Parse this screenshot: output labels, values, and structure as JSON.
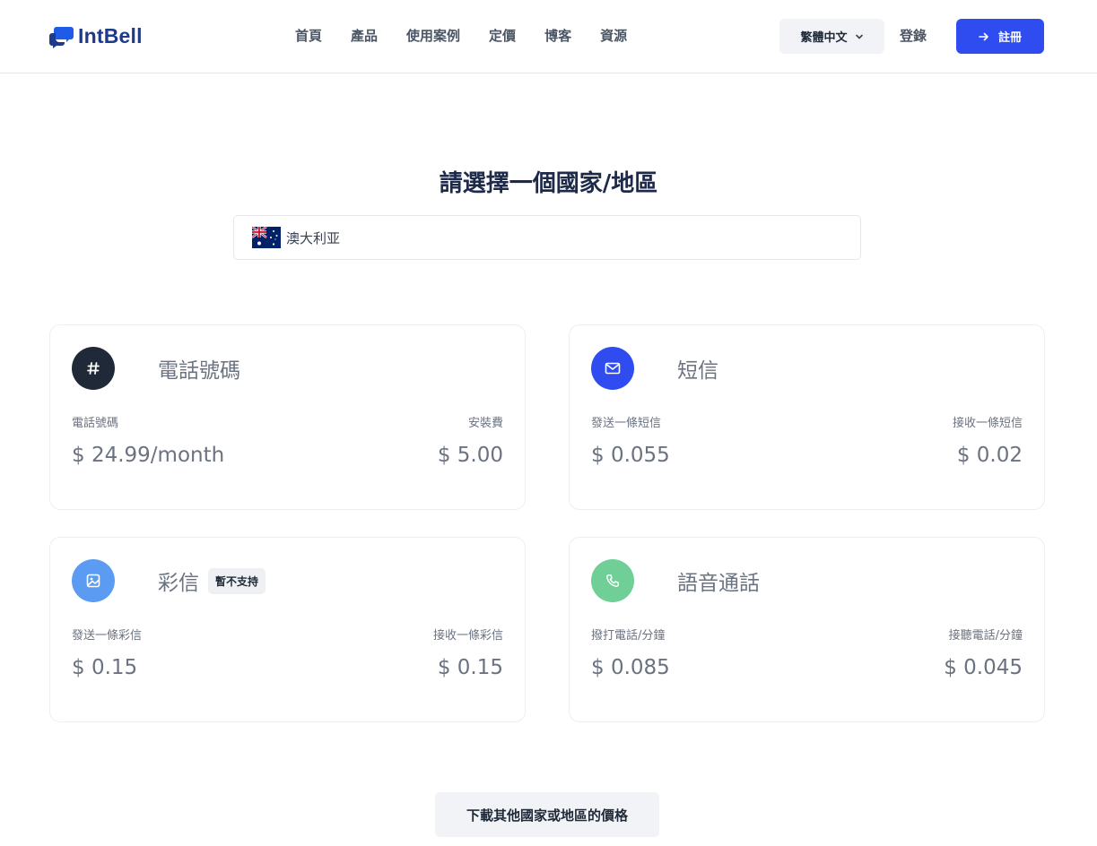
{
  "header": {
    "logo_text": "IntBell",
    "nav": [
      "首頁",
      "產品",
      "使用案例",
      "定價",
      "博客",
      "資源"
    ],
    "language": "繁體中文",
    "login": "登錄",
    "signup": "註冊"
  },
  "main": {
    "title": "請選擇一個國家/地區",
    "country": "澳大利亚",
    "download_button": "下載其他國家或地區的價格"
  },
  "cards": {
    "phone": {
      "title": "電話號碼",
      "label_left": "電話號碼",
      "label_right": "安裝費",
      "value_left": "$ 24.99/month",
      "value_right": "$ 5.00",
      "icon": "hash-icon",
      "color": "#1f2937"
    },
    "sms": {
      "title": "短信",
      "label_left": "發送一條短信",
      "label_right": "接收一條短信",
      "value_left": "$ 0.055",
      "value_right": "$ 0.02",
      "icon": "mail-icon",
      "color": "#2f4cf0"
    },
    "mms": {
      "title": "彩信",
      "badge": "暫不支持",
      "label_left": "發送一條彩信",
      "label_right": "接收一條彩信",
      "value_left": "$ 0.15",
      "value_right": "$ 0.15",
      "icon": "image-icon",
      "color": "#5b9cf2"
    },
    "voice": {
      "title": "語音通話",
      "label_left": "撥打電話/分鐘",
      "label_right": "接聽電話/分鐘",
      "value_left": "$ 0.085",
      "value_right": "$ 0.045",
      "icon": "phone-icon",
      "color": "#6fcf97"
    }
  }
}
